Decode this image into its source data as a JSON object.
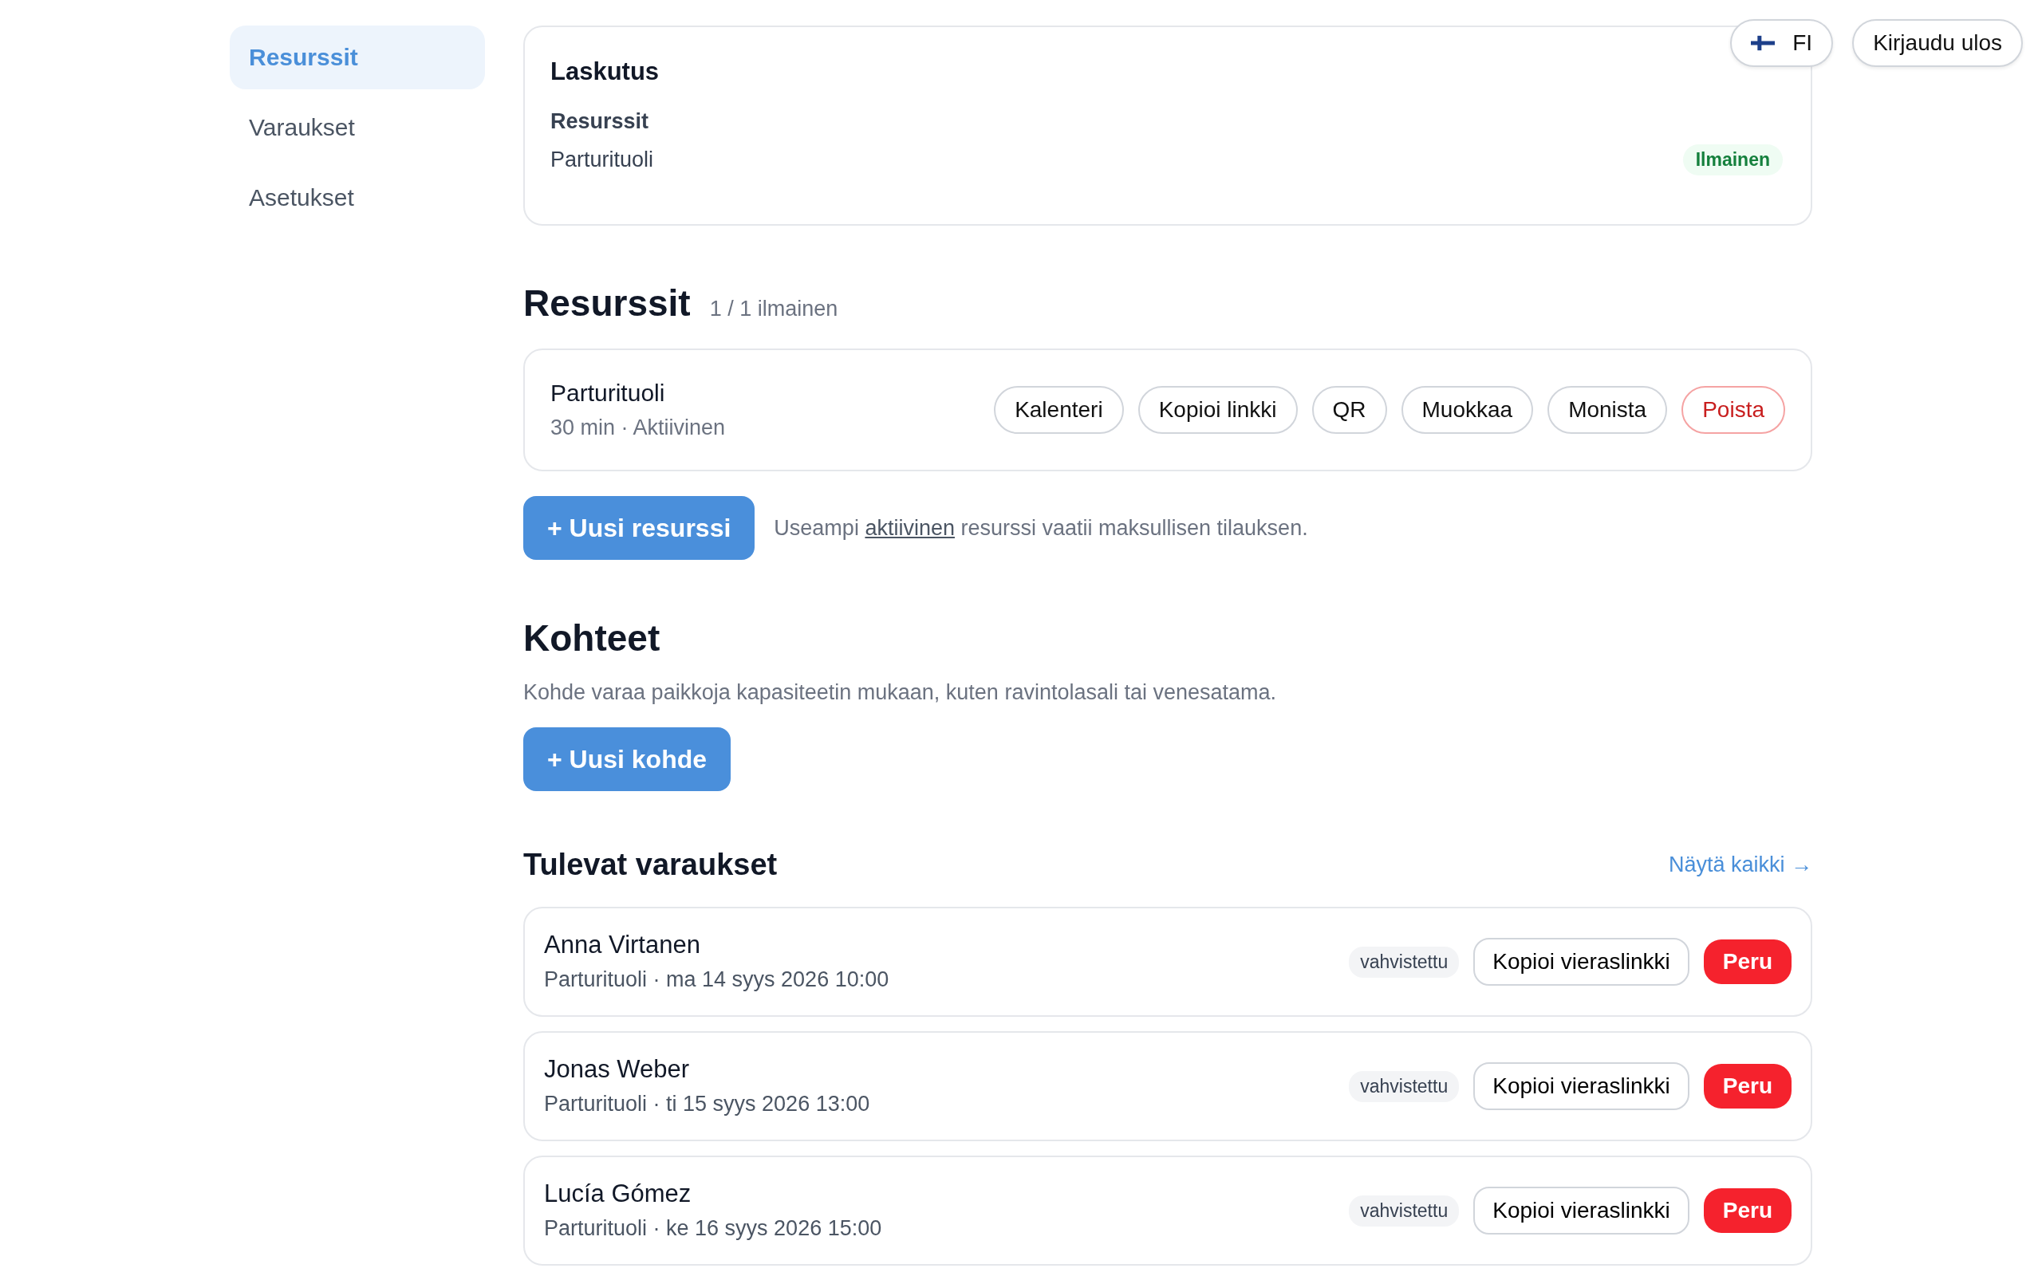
{
  "sidebar": {
    "items": [
      {
        "label": "Resurssit",
        "selected": true
      },
      {
        "label": "Varaukset",
        "selected": false
      },
      {
        "label": "Asetukset",
        "selected": false
      }
    ]
  },
  "top_bar": {
    "language_button": "FI",
    "logout_button": "Kirjaudu ulos"
  },
  "billing": {
    "title": "Laskutus",
    "section_label": "Resurssit",
    "rows": [
      {
        "name": "Parturituoli",
        "badge": "Ilmainen"
      }
    ]
  },
  "resources": {
    "title": "Resurssit",
    "count": "1 / 1 ilmainen",
    "items": [
      {
        "name": "Parturituoli",
        "meta": "30 min · Aktiivinen",
        "actions": [
          {
            "label": "Kalenteri",
            "kind": "default"
          },
          {
            "label": "Kopioi linkki",
            "kind": "default"
          },
          {
            "label": "QR",
            "kind": "default"
          },
          {
            "label": "Muokkaa",
            "kind": "default"
          },
          {
            "label": "Monista",
            "kind": "default"
          },
          {
            "label": "Poista",
            "kind": "danger"
          }
        ]
      }
    ],
    "add_button": "+ Uusi resurssi",
    "note_before": "Useampi",
    "note_link": "aktiivinen",
    "note_after": "resurssi vaatii maksullisen tilauksen."
  },
  "venues": {
    "title": "Kohteet",
    "description": "Kohde varaa paikkoja kapasiteetin mukaan, kuten ravintolasali tai venesatama.",
    "add_button": "+ Uusi kohde"
  },
  "upcoming": {
    "title": "Tulevat varaukset",
    "view_all": "Näytä kaikki →",
    "bookings": [
      {
        "name": "Anna Virtanen",
        "detail": "Parturituoli · ma 14 syys 2026 10:00",
        "status": "vahvistettu",
        "copy_button": "Kopioi vieraslinkki",
        "cancel_button": "Peru"
      },
      {
        "name": "Jonas Weber",
        "detail": "Parturituoli · ti 15 syys 2026 13:00",
        "status": "vahvistettu",
        "copy_button": "Kopioi vieraslinkki",
        "cancel_button": "Peru"
      },
      {
        "name": "Lucía Gómez",
        "detail": "Parturituoli · ke 16 syys 2026 15:00",
        "status": "vahvistettu",
        "copy_button": "Kopioi vieraslinkki",
        "cancel_button": "Peru"
      }
    ]
  }
}
